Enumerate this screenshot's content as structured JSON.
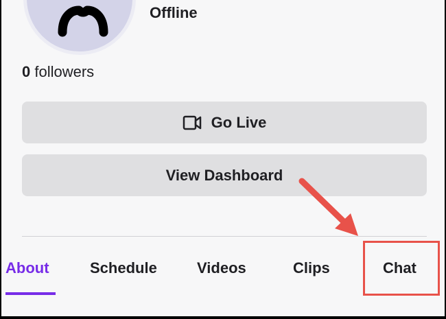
{
  "profile": {
    "status": "Offline",
    "followers_count": "0",
    "followers_label": "followers"
  },
  "actions": {
    "go_live_label": "Go Live",
    "dashboard_label": "View Dashboard"
  },
  "tabs": [
    {
      "label": "About",
      "active": true
    },
    {
      "label": "Schedule",
      "active": false
    },
    {
      "label": "Videos",
      "active": false
    },
    {
      "label": "Clips",
      "active": false
    },
    {
      "label": "Chat",
      "active": false
    }
  ],
  "colors": {
    "accent": "#772ce8",
    "annotation": "#e8524a"
  },
  "icons": {
    "go_live": "video-camera-icon"
  }
}
